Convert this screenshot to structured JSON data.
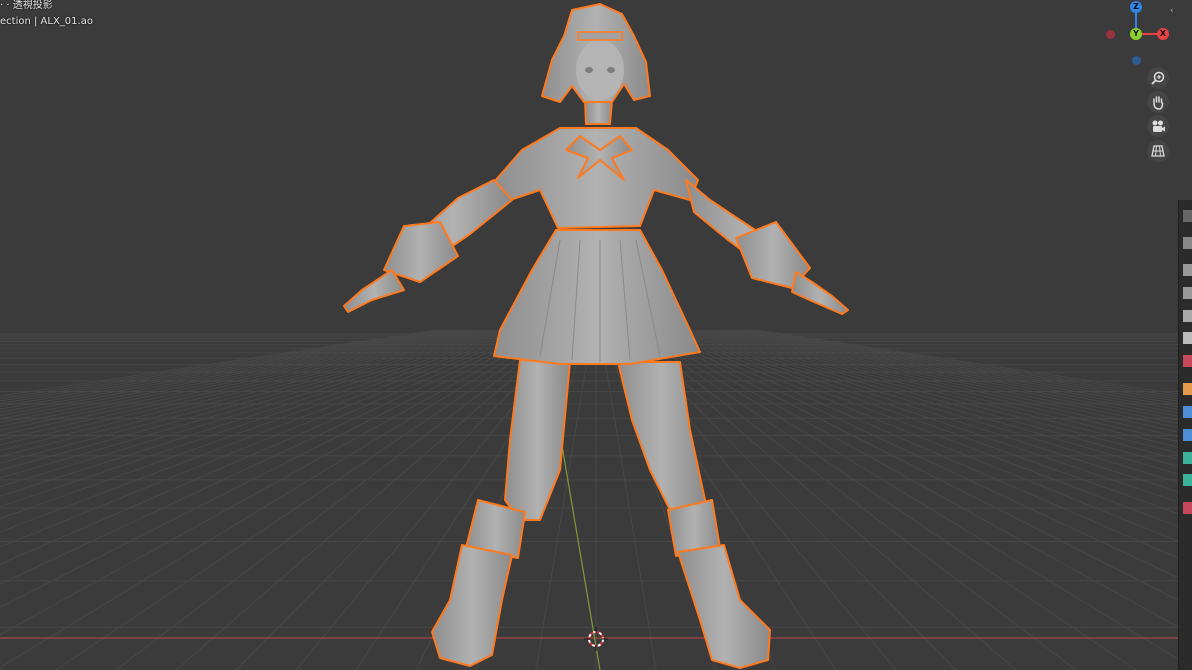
{
  "viewport": {
    "view_mode": "· · 透視投影",
    "collection_info": "ection | ALX_01.ao"
  },
  "gizmo": {
    "axes": {
      "z": "Z",
      "y": "Y",
      "x": "X"
    },
    "colors": {
      "x": "#e8413f",
      "y": "#8ccf2f",
      "z": "#2f86e5",
      "x_neg": "#9a3340",
      "z_neg": "#2e5d92"
    }
  },
  "nav_buttons": [
    {
      "name": "zoom-icon"
    },
    {
      "name": "pan-hand-icon"
    },
    {
      "name": "camera-icon"
    },
    {
      "name": "grid-ortho-icon"
    }
  ],
  "colors": {
    "background": "#3b3b3b",
    "grid_line": "#474747",
    "x_axis_line": "#b2484a",
    "y_axis_line": "#8aa33a",
    "selection_outline": "#ff7a1f",
    "model": "#a9a9a9"
  },
  "props_tabs": [
    "tool-icon",
    "render-icon",
    "output-icon",
    "view-layer-icon",
    "scene-icon",
    "world-icon",
    "object-icon",
    "modifier-icon",
    "particles-icon",
    "physics-icon",
    "constraints-icon",
    "data-icon",
    "texture-icon"
  ]
}
